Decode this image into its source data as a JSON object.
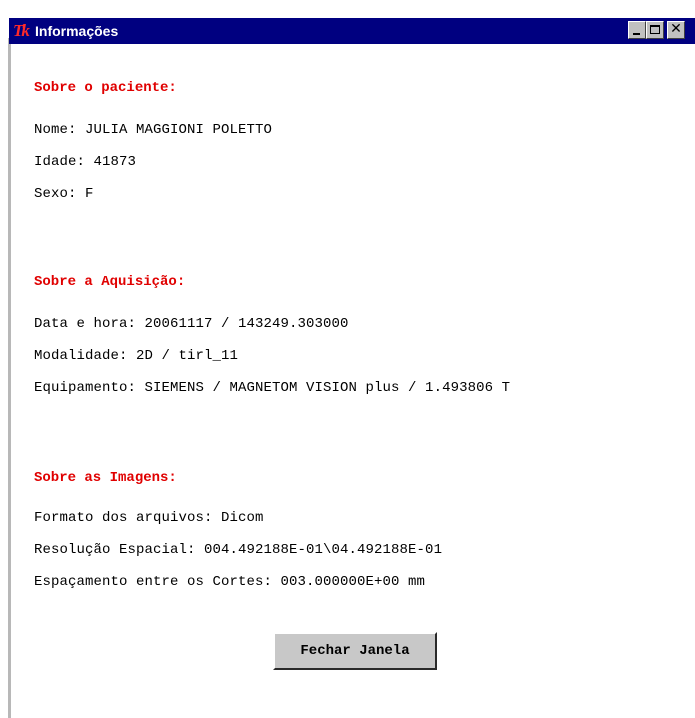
{
  "window": {
    "title": "Informações",
    "logo_text": "Tk",
    "controls": {
      "minimize": "minimize-icon",
      "maximize": "maximize-icon",
      "close": "close-icon"
    }
  },
  "patient": {
    "heading": "Sobre o paciente:",
    "name": "Nome: JULIA MAGGIONI POLETTO",
    "age": "Idade: 41873",
    "sex": "Sexo: F"
  },
  "acquisition": {
    "heading": "Sobre a Aquisição:",
    "datetime": "Data e hora: 20061117 / 143249.303000",
    "modality": "Modalidade: 2D / tirl_11",
    "equipment": "Equipamento: SIEMENS / MAGNETOM VISION plus / 1.493806 T"
  },
  "images": {
    "heading": "Sobre as Imagens:",
    "format": "Formato dos arquivos: Dicom",
    "resolution": "Resolução Espacial: 004.492188E-01\\04.492188E-01",
    "spacing": "Espaçamento entre os Cortes: 003.000000E+00 mm"
  },
  "actions": {
    "close_label": "Fechar Janela"
  },
  "colors": {
    "titlebar": "#000080",
    "heading": "#e00000",
    "button": "#c8c8c8"
  }
}
